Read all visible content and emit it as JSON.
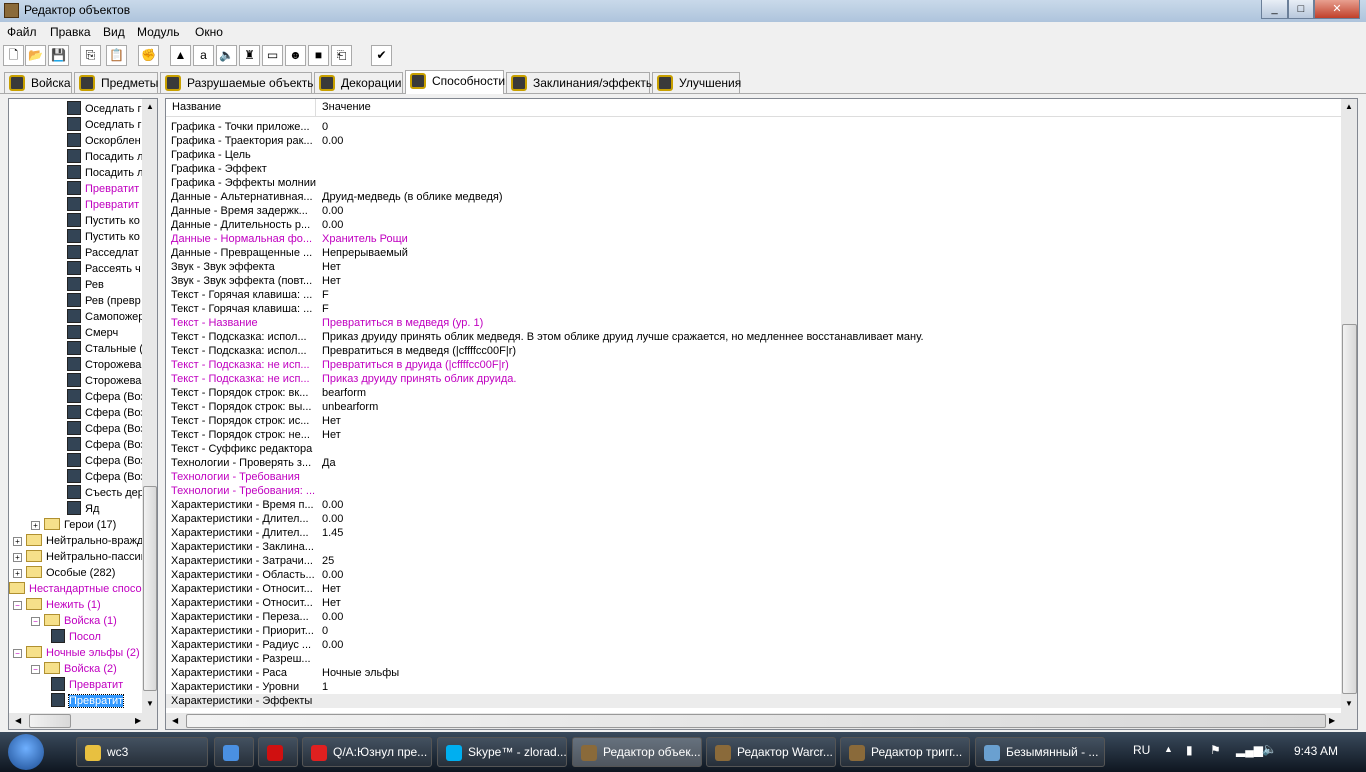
{
  "window": {
    "title": "Редактор объектов",
    "min": "_",
    "max": "□",
    "close": "✕"
  },
  "menu": [
    "Файл",
    "Правка",
    "Вид",
    "Модуль",
    "Окно"
  ],
  "toolbar": [
    {
      "name": "new",
      "g": "🗋"
    },
    {
      "name": "open",
      "g": "📂"
    },
    {
      "name": "save",
      "g": "💾"
    },
    {
      "name": "copy",
      "g": "⎘"
    },
    {
      "name": "paste",
      "g": "📋"
    },
    {
      "name": "abilities",
      "g": "✊"
    },
    {
      "name": "terrain",
      "g": "▲"
    },
    {
      "name": "text",
      "g": "a"
    },
    {
      "name": "sound",
      "g": "🔈"
    },
    {
      "name": "object",
      "g": "♜"
    },
    {
      "name": "camera",
      "g": "▭"
    },
    {
      "name": "ai",
      "g": "☻"
    },
    {
      "name": "import",
      "g": "■"
    },
    {
      "name": "export",
      "g": "⎗"
    },
    {
      "name": "test",
      "g": "✔"
    }
  ],
  "tabs": [
    "Войска",
    "Предметы",
    "Разрушаемые объекты",
    "Декорации",
    "Способности",
    "Заклинания/эффекты",
    "Улучшения"
  ],
  "active_tab": 4,
  "tree": [
    {
      "l": 4,
      "t": "Оседлать г"
    },
    {
      "l": 4,
      "t": "Оседлать г"
    },
    {
      "l": 4,
      "t": "Оскорблен"
    },
    {
      "l": 4,
      "t": "Посадить л"
    },
    {
      "l": 4,
      "t": "Посадить л"
    },
    {
      "l": 4,
      "t": "Превратит",
      "m": 1
    },
    {
      "l": 4,
      "t": "Превратит",
      "m": 1
    },
    {
      "l": 4,
      "t": "Пустить ко"
    },
    {
      "l": 4,
      "t": "Пустить ко"
    },
    {
      "l": 4,
      "t": "Расседлат"
    },
    {
      "l": 4,
      "t": "Рассеять ч"
    },
    {
      "l": 4,
      "t": "Рев"
    },
    {
      "l": 4,
      "t": "Рев (превр"
    },
    {
      "l": 4,
      "t": "Самопожер"
    },
    {
      "l": 4,
      "t": "Смерч"
    },
    {
      "l": 4,
      "t": "Стальные ("
    },
    {
      "l": 4,
      "t": "Сторожева"
    },
    {
      "l": 4,
      "t": "Сторожева"
    },
    {
      "l": 4,
      "t": "Сфера (Воз"
    },
    {
      "l": 4,
      "t": "Сфера (Воз"
    },
    {
      "l": 4,
      "t": "Сфера (Воз"
    },
    {
      "l": 4,
      "t": "Сфера (Воз"
    },
    {
      "l": 4,
      "t": "Сфера (Воз"
    },
    {
      "l": 4,
      "t": "Сфера (Воз"
    },
    {
      "l": 4,
      "t": "Съесть дер"
    },
    {
      "l": 4,
      "t": "Яд"
    },
    {
      "l": 2,
      "t": "Герои (17)",
      "f": 1,
      "pm": "+"
    },
    {
      "l": 1,
      "t": "Нейтрально-враждебные",
      "f": 1,
      "pm": "+"
    },
    {
      "l": 1,
      "t": "Нейтрально-пассивные",
      "f": 1,
      "pm": "+"
    },
    {
      "l": 1,
      "t": "Особые (282)",
      "f": 1,
      "pm": "+"
    },
    {
      "l": 0,
      "t": "Нестандартные способности",
      "f": 1,
      "m": 1
    },
    {
      "l": 1,
      "t": "Нежить (1)",
      "f": 1,
      "m": 1,
      "pm": "−"
    },
    {
      "l": 2,
      "t": "Войска (1)",
      "f": 1,
      "m": 1,
      "pm": "−"
    },
    {
      "l": 3,
      "t": "Посол",
      "m": 1
    },
    {
      "l": 1,
      "t": "Ночные эльфы (2)",
      "f": 1,
      "m": 1,
      "pm": "−"
    },
    {
      "l": 2,
      "t": "Войска (2)",
      "f": 1,
      "m": 1,
      "pm": "−"
    },
    {
      "l": 3,
      "t": "Превратит",
      "m": 1
    },
    {
      "l": 3,
      "t": "Превратит",
      "m": 1,
      "s": 1
    }
  ],
  "grid": {
    "col_name": "Название",
    "col_value": "Значение",
    "rows": [
      [
        "Графика - Точки приложе...",
        "0"
      ],
      [
        "Графика - Траектория рак...",
        "0.00"
      ],
      [
        "Графика - Цель",
        ""
      ],
      [
        "Графика - Эффект",
        ""
      ],
      [
        "Графика - Эффекты молнии",
        ""
      ],
      [
        "Данные - Альтернативная...",
        "Друид-медведь (в облике медведя)"
      ],
      [
        "Данные - Время задержк...",
        "0.00"
      ],
      [
        "Данные - Длительность р...",
        "0.00"
      ],
      [
        "Данные - Нормальная фо...",
        "Хранитель Рощи",
        1
      ],
      [
        "Данные - Превращенные ...",
        "Непрерываемый"
      ],
      [
        "Звук - Звук эффекта",
        "Нет"
      ],
      [
        "Звук - Звук эффекта (повт...",
        "Нет"
      ],
      [
        "Текст - Горячая клавиша: ...",
        "F"
      ],
      [
        "Текст - Горячая клавиша: ...",
        "F"
      ],
      [
        "Текст - Название",
        "Превратиться в медведя (ур. 1)",
        1
      ],
      [
        "Текст - Подсказка: испол...",
        "Приказ друиду принять облик медведя. В этом облике друид лучше сражается, но медленнее восстанавливает ману."
      ],
      [
        "Текст - Подсказка: испол...",
        "Превратиться в медведя (|cffffcc00F|r)"
      ],
      [
        "Текст - Подсказка: не исп...",
        "Превратиться в друида (|cffffcc00F|r)",
        1
      ],
      [
        "Текст - Подсказка: не исп...",
        "Приказ друиду принять облик друида.",
        1
      ],
      [
        "Текст - Порядок строк: вк...",
        "bearform"
      ],
      [
        "Текст - Порядок строк: вы...",
        "unbearform"
      ],
      [
        "Текст - Порядок строк: ис...",
        "Нет"
      ],
      [
        "Текст - Порядок строк: не...",
        "Нет"
      ],
      [
        "Текст - Суффикс редактора",
        ""
      ],
      [
        "Технологии - Проверять з...",
        "Да"
      ],
      [
        "Технологии - Требования",
        "",
        1
      ],
      [
        "Технологии - Требования: ...",
        "",
        1
      ],
      [
        "Характеристики - Время п...",
        "0.00"
      ],
      [
        "Характеристики - Длител...",
        "0.00"
      ],
      [
        "Характеристики - Длител...",
        "1.45"
      ],
      [
        "Характеристики - Заклина...",
        ""
      ],
      [
        "Характеристики - Затрачи...",
        "25"
      ],
      [
        "Характеристики - Область...",
        "0.00"
      ],
      [
        "Характеристики - Относит...",
        "Нет"
      ],
      [
        "Характеристики - Относит...",
        "Нет"
      ],
      [
        "Характеристики - Переза...",
        "0.00"
      ],
      [
        "Характеристики - Приорит...",
        "0"
      ],
      [
        "Характеристики - Радиус ...",
        "0.00"
      ],
      [
        "Характеристики - Разреш...",
        ""
      ],
      [
        "Характеристики - Раса",
        "Ночные эльфы"
      ],
      [
        "Характеристики - Уровни",
        "1"
      ],
      [
        "Характеристики - Эффекты",
        ""
      ]
    ]
  },
  "taskbar": {
    "items": [
      {
        "t": "wc3",
        "c": "#e8c040"
      },
      {
        "t": "",
        "c": "#4a90e2"
      },
      {
        "t": "",
        "c": "#d01010"
      },
      {
        "t": "Q/A:Юзнул пре...",
        "c": "#e02020"
      },
      {
        "t": "Skype™ - zlorad...",
        "c": "#00aff0"
      },
      {
        "t": "Редактор объек...",
        "c": "#8a6a3a",
        "a": 1
      },
      {
        "t": "Редактор Warcr...",
        "c": "#8a6a3a"
      },
      {
        "t": "Редактор тригг...",
        "c": "#8a6a3a"
      },
      {
        "t": "Безымянный - ...",
        "c": "#6aa0d0"
      }
    ],
    "lang": "RU",
    "time": "9:43 AM"
  },
  "colors": {
    "modified": "#c000c0",
    "selection": "#3399ff"
  }
}
